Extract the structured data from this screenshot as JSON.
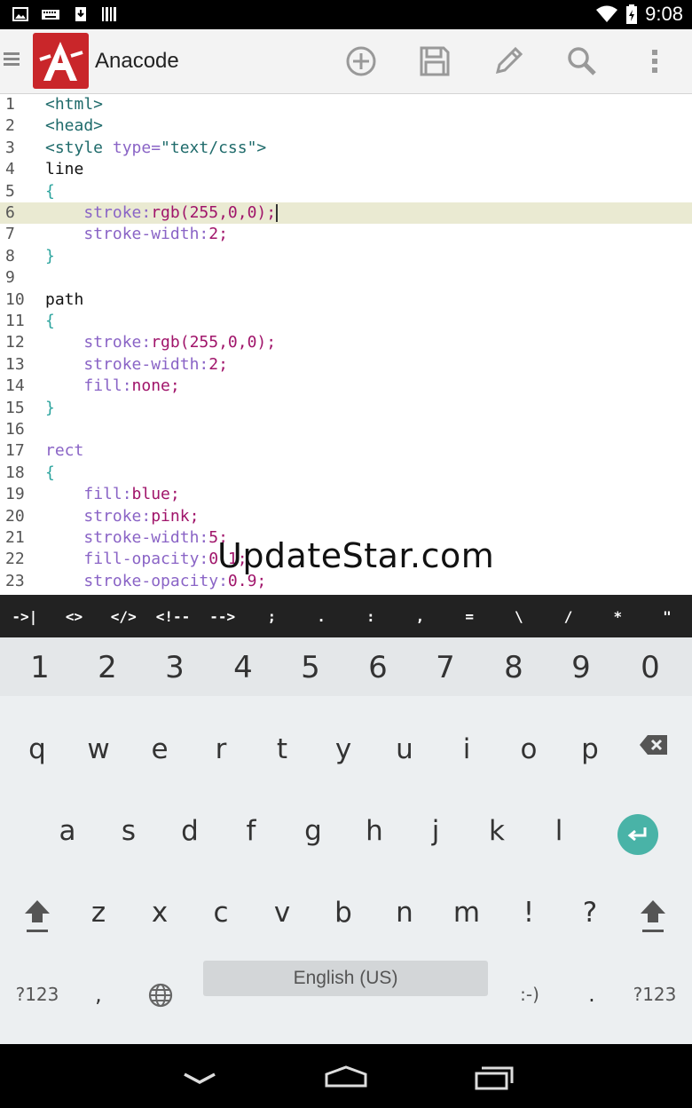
{
  "status_bar": {
    "time": "9:08",
    "left_icons": [
      "image-icon",
      "keyboard-icon",
      "download-icon",
      "barcode-icon"
    ],
    "right_icons": [
      "wifi-icon",
      "battery-icon"
    ]
  },
  "action_bar": {
    "app_name": "Anacode",
    "actions": [
      "add-icon",
      "save-icon",
      "edit-icon",
      "search-icon",
      "overflow-menu-icon"
    ],
    "logo_color": "#c9262a"
  },
  "editor": {
    "current_line": 6,
    "lines": [
      {
        "n": "1",
        "tokens": [
          {
            "t": "tag",
            "v": "<html>"
          }
        ]
      },
      {
        "n": "2",
        "tokens": [
          {
            "t": "tag",
            "v": "<head>"
          }
        ]
      },
      {
        "n": "3",
        "tokens": [
          {
            "t": "tag",
            "v": "<style "
          },
          {
            "t": "attr",
            "v": "type="
          },
          {
            "t": "str",
            "v": "\"text/css\""
          },
          {
            "t": "tag",
            "v": ">"
          }
        ]
      },
      {
        "n": "4",
        "tokens": [
          {
            "t": "plain",
            "v": "line"
          }
        ]
      },
      {
        "n": "5",
        "tokens": [
          {
            "t": "brace",
            "v": "{"
          }
        ]
      },
      {
        "n": "6",
        "tokens": [
          {
            "t": "plain",
            "v": "    "
          },
          {
            "t": "prop",
            "v": "stroke:"
          },
          {
            "t": "val",
            "v": "rgb(255,0,0);"
          }
        ]
      },
      {
        "n": "7",
        "tokens": [
          {
            "t": "plain",
            "v": "    "
          },
          {
            "t": "prop",
            "v": "stroke-width:"
          },
          {
            "t": "val",
            "v": "2;"
          }
        ]
      },
      {
        "n": "8",
        "tokens": [
          {
            "t": "brace",
            "v": "}"
          }
        ]
      },
      {
        "n": "9",
        "tokens": []
      },
      {
        "n": "10",
        "tokens": [
          {
            "t": "plain",
            "v": "path"
          }
        ]
      },
      {
        "n": "11",
        "tokens": [
          {
            "t": "brace",
            "v": "{"
          }
        ]
      },
      {
        "n": "12",
        "tokens": [
          {
            "t": "plain",
            "v": "    "
          },
          {
            "t": "prop",
            "v": "stroke:"
          },
          {
            "t": "val",
            "v": "rgb(255,0,0);"
          }
        ]
      },
      {
        "n": "13",
        "tokens": [
          {
            "t": "plain",
            "v": "    "
          },
          {
            "t": "prop",
            "v": "stroke-width:"
          },
          {
            "t": "val",
            "v": "2;"
          }
        ]
      },
      {
        "n": "14",
        "tokens": [
          {
            "t": "plain",
            "v": "    "
          },
          {
            "t": "prop",
            "v": "fill:"
          },
          {
            "t": "val",
            "v": "none;"
          }
        ]
      },
      {
        "n": "15",
        "tokens": [
          {
            "t": "brace",
            "v": "}"
          }
        ]
      },
      {
        "n": "16",
        "tokens": []
      },
      {
        "n": "17",
        "tokens": [
          {
            "t": "sel",
            "v": "rect"
          }
        ]
      },
      {
        "n": "18",
        "tokens": [
          {
            "t": "brace",
            "v": "{"
          }
        ]
      },
      {
        "n": "19",
        "tokens": [
          {
            "t": "plain",
            "v": "    "
          },
          {
            "t": "prop",
            "v": "fill:"
          },
          {
            "t": "val",
            "v": "blue;"
          }
        ]
      },
      {
        "n": "20",
        "tokens": [
          {
            "t": "plain",
            "v": "    "
          },
          {
            "t": "prop",
            "v": "stroke:"
          },
          {
            "t": "val",
            "v": "pink;"
          }
        ]
      },
      {
        "n": "21",
        "tokens": [
          {
            "t": "plain",
            "v": "    "
          },
          {
            "t": "prop",
            "v": "stroke-width:"
          },
          {
            "t": "val",
            "v": "5;"
          }
        ]
      },
      {
        "n": "22",
        "tokens": [
          {
            "t": "plain",
            "v": "    "
          },
          {
            "t": "prop",
            "v": "fill-opacity:"
          },
          {
            "t": "val",
            "v": "0.1;"
          }
        ]
      },
      {
        "n": "23",
        "tokens": [
          {
            "t": "plain",
            "v": "    "
          },
          {
            "t": "prop",
            "v": "stroke-opacity:"
          },
          {
            "t": "val",
            "v": "0.9;"
          }
        ]
      }
    ]
  },
  "watermark": "UpdateStar.com",
  "symbol_row": [
    "->|",
    "<>",
    "</>",
    "<!--",
    "-->",
    ";",
    ".",
    ":",
    ",",
    "=",
    "\\",
    "/",
    "*",
    "\""
  ],
  "keyboard": {
    "numbers": [
      "1",
      "2",
      "3",
      "4",
      "5",
      "6",
      "7",
      "8",
      "9",
      "0"
    ],
    "row1": [
      "q",
      "w",
      "e",
      "r",
      "t",
      "y",
      "u",
      "i",
      "o",
      "p"
    ],
    "row2": [
      "a",
      "s",
      "d",
      "f",
      "g",
      "h",
      "j",
      "k",
      "l"
    ],
    "row3": [
      "z",
      "x",
      "c",
      "v",
      "b",
      "n",
      "m",
      "!",
      "?"
    ],
    "symbols_key": "?123",
    "comma_key": ",",
    "space_label": "English (US)",
    "smiley_key": ":-)",
    "period_key": ".",
    "enter_color": "#49b3a7"
  },
  "nav_bar": {
    "buttons": [
      "back-icon",
      "home-icon",
      "recents-icon"
    ]
  }
}
